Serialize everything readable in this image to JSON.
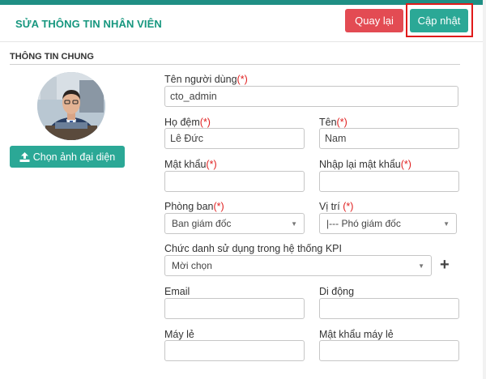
{
  "header": {
    "title": "SỬA THÔNG TIN NHÂN VIÊN",
    "back_label": "Quay lại",
    "update_label": "Cập nhật"
  },
  "section": {
    "title": "THÔNG TIN CHUNG"
  },
  "avatar": {
    "button_label": "Chọn ảnh đại diện",
    "button_icon": "upload-icon"
  },
  "form": {
    "username": {
      "label": "Tên người dùng",
      "required": "(*)",
      "value": "cto_admin"
    },
    "surname": {
      "label": "Họ đệm",
      "required": "(*)",
      "value": "Lê Đức"
    },
    "firstname": {
      "label": "Tên",
      "required": "(*)",
      "value": "Nam"
    },
    "password": {
      "label": "Mật khẩu",
      "required": "(*)",
      "value": ""
    },
    "password_confirm": {
      "label": "Nhập lại mật khẩu",
      "required": "(*)",
      "value": ""
    },
    "department": {
      "label": "Phòng ban",
      "required": "(*)",
      "value": "Ban giám đốc"
    },
    "position": {
      "label": "Vị trí",
      "required": "(*)",
      "value": "|--- Phó giám đốc"
    },
    "kpi_title": {
      "label": "Chức danh sử dụng trong hệ thống KPI",
      "value": "Mời chọn"
    },
    "email": {
      "label": "Email",
      "value": ""
    },
    "mobile": {
      "label": "Di động",
      "value": ""
    },
    "extension": {
      "label": "Máy lẻ",
      "value": ""
    },
    "extension_password": {
      "label": "Mật khẩu máy lẻ",
      "value": ""
    }
  },
  "colors": {
    "accent": "#2ba896",
    "danger": "#e34b53",
    "title": "#17977f",
    "required": "#e02020"
  }
}
